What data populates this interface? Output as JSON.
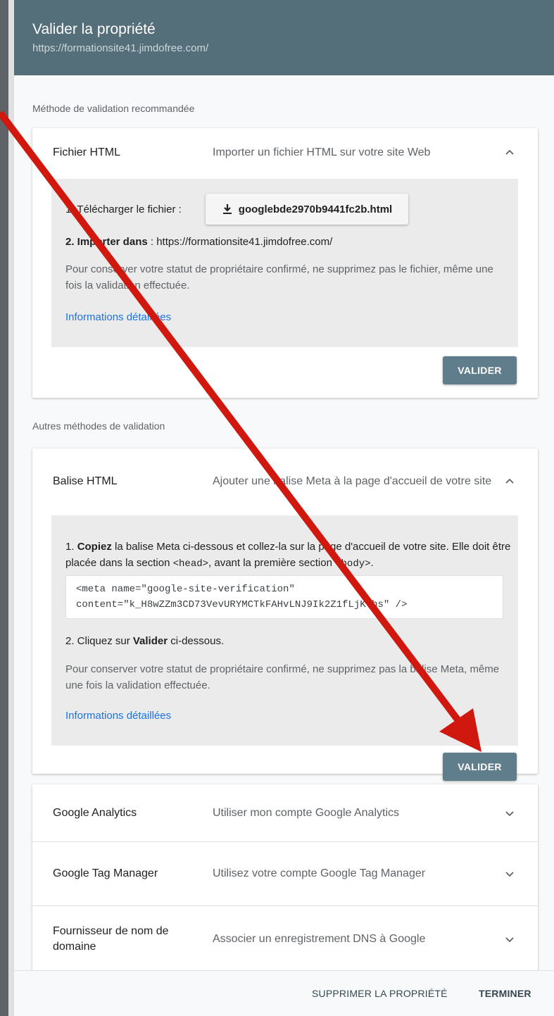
{
  "dialog": {
    "title": "Valider la propriété",
    "url": "https://formationsite41.jimdofree.com/"
  },
  "recommended": {
    "section_label": "Méthode de validation recommandée",
    "name": "Fichier HTML",
    "description": "Importer un fichier HTML sur votre site Web",
    "step1_label": "1. Télécharger le fichier :",
    "download_file": "googlebde2970b9441fc2b.html",
    "step2_bold": "2. Importer dans",
    "step2_rest": " : https://formationsite41.jimdofree.com/",
    "note": "Pour conserver votre statut de propriétaire confirmé, ne supprimez pas le fichier, même une fois la validation effectuée.",
    "more_info": "Informations détaillées",
    "validate": "VALIDER"
  },
  "others": {
    "section_label": "Autres méthodes de validation",
    "meta": {
      "name": "Balise HTML",
      "description": "Ajouter une balise Meta à la page d'accueil de votre site",
      "step1_num": "1.",
      "step1_bold": "Copiez",
      "step1_rest": " la balise Meta ci-dessous et collez-la sur la page d'accueil de votre site. Elle doit être placée dans la section ",
      "step1_head": "<head>",
      "step1_mid": ", avant la première section ",
      "step1_body": "<body>",
      "step1_end": ".",
      "code_line1": "<meta name=\"google-site-verification\"",
      "code_line2": "content=\"k_H8wZZm3CD73VevURYMCTkFAHvLNJ9Ik2Z1fLjKths\" />",
      "step2_pre": "2. Cliquez sur ",
      "step2_bold": "Valider",
      "step2_post": " ci-dessous.",
      "note": "Pour conserver votre statut de propriétaire confirmé, ne supprimez pas la balise Meta, même une fois la validation effectuée.",
      "more_info": "Informations détaillées",
      "validate": "VALIDER"
    },
    "rows": [
      {
        "name": "Google Analytics",
        "description": "Utiliser mon compte Google Analytics"
      },
      {
        "name": "Google Tag Manager",
        "description": "Utilisez votre compte Google Tag Manager"
      },
      {
        "name": "Fournisseur de nom de domaine",
        "description": "Associer un enregistrement DNS à Google"
      }
    ]
  },
  "footer": {
    "delete": "SUPPRIMER LA PROPRIÉTÉ",
    "done": "TERMINER"
  },
  "colors": {
    "header": "#546e7a",
    "validate_button": "#607d8b",
    "link": "#1a73e8",
    "annotation_arrow": "#d0180f"
  }
}
